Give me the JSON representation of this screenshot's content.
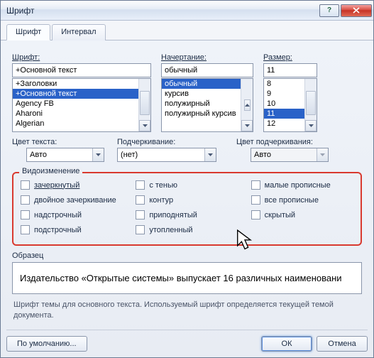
{
  "window": {
    "title": "Шрифт"
  },
  "tabs": {
    "font": "Шрифт",
    "spacing": "Интервал"
  },
  "font": {
    "label": "Шрифт:",
    "value": "+Основной текст",
    "list": [
      "+Заголовки",
      "+Основной текст",
      "Agency FB",
      "Aharoni",
      "Algerian"
    ],
    "selectedIndex": 1
  },
  "style": {
    "label": "Начертание:",
    "value": "обычный",
    "list": [
      "обычный",
      "курсив",
      "полужирный",
      "полужирный курсив"
    ],
    "selectedIndex": 0
  },
  "size": {
    "label": "Размер:",
    "value": "11",
    "list": [
      "8",
      "9",
      "10",
      "11",
      "12"
    ],
    "selectedIndex": 3
  },
  "color": {
    "label": "Цвет текста:",
    "value": "Авто"
  },
  "underline": {
    "label": "Подчеркивание:",
    "value": "(нет)"
  },
  "underline_color": {
    "label": "Цвет подчеркивания:",
    "value": "Авто"
  },
  "effects": {
    "title": "Видоизменение",
    "col1": {
      "a": "зачеркнутый",
      "b": "двойное зачеркивание",
      "c": "надстрочный",
      "d": "подстрочный"
    },
    "col2": {
      "a": "с тенью",
      "b": "контур",
      "c": "приподнятый",
      "d": "утопленный"
    },
    "col3": {
      "a": "малые прописные",
      "b": "все прописные",
      "c": "скрытый"
    }
  },
  "sample": {
    "label": "Образец",
    "text": "Издательство «Открытые системы» выпускает 16 различных наименовани"
  },
  "hint": "Шрифт темы для основного текста. Используемый шрифт определяется текущей темой документа.",
  "buttons": {
    "defaults": "По умолчанию...",
    "ok": "ОК",
    "cancel": "Отмена"
  }
}
